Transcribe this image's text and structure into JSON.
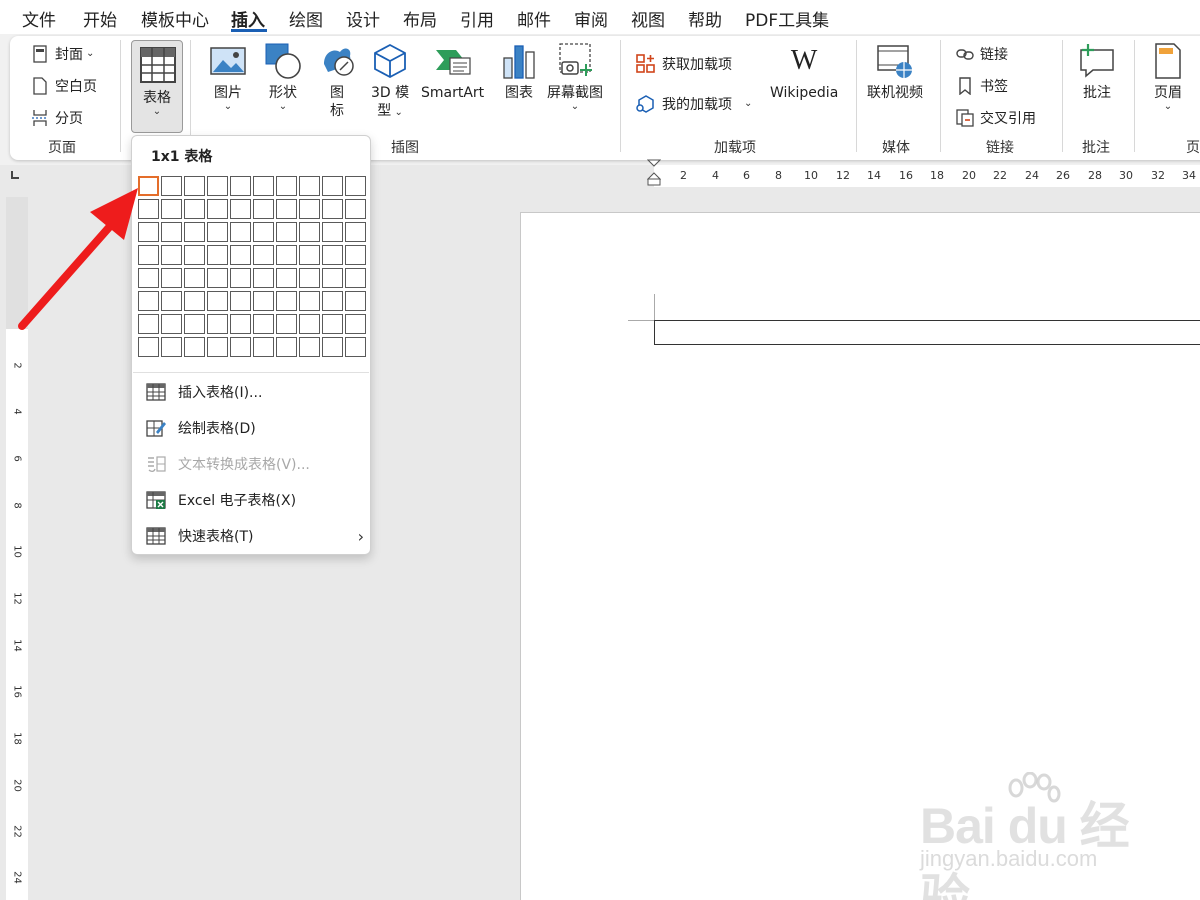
{
  "menu": {
    "tabs": [
      "文件",
      "开始",
      "模板中心",
      "插入",
      "绘图",
      "设计",
      "布局",
      "引用",
      "邮件",
      "审阅",
      "视图",
      "帮助",
      "PDF工具集"
    ],
    "active": "插入"
  },
  "ribbon": {
    "page_group": {
      "label": "页面",
      "items": [
        "封面",
        "空白页",
        "分页"
      ]
    },
    "table_group": {
      "button": "表格"
    },
    "illustrations_group": {
      "label": "插图",
      "picture": "图片",
      "shapes": "形状",
      "icons_l1": "图",
      "icons_l2": "标",
      "model_l1": "3D 模",
      "model_l2": "型",
      "smartart": "SmartArt",
      "chart": "图表",
      "screenshot": "屏幕截图"
    },
    "addins_group": {
      "label": "加载项",
      "get_addins": "获取加载项",
      "my_addins": "我的加载项",
      "wikipedia": "Wikipedia"
    },
    "media_group": {
      "label": "媒体",
      "online_video": "联机视频"
    },
    "links_group": {
      "label": "链接",
      "link": "链接",
      "bookmark": "书签",
      "cross_ref": "交叉引用"
    },
    "comments_group": {
      "label": "批注",
      "comment": "批注"
    },
    "header_group": {
      "label": "页",
      "header": "页眉"
    }
  },
  "ruler": {
    "h_ticks": [
      "2",
      "4",
      "6",
      "8",
      "10",
      "12",
      "14",
      "16",
      "18",
      "20",
      "22",
      "24",
      "26",
      "28",
      "30",
      "32",
      "34"
    ],
    "v_ticks": [
      "2",
      "4",
      "6",
      "8",
      "10",
      "12",
      "14",
      "16",
      "18",
      "20",
      "22",
      "24"
    ]
  },
  "dropdown": {
    "title": "1x1 表格",
    "grid_cols": 10,
    "grid_rows": 8,
    "selected_cols": 1,
    "selected_rows": 1,
    "items": [
      {
        "label": "插入表格(I)...",
        "enabled": true
      },
      {
        "label": "绘制表格(D)",
        "enabled": true
      },
      {
        "label": "文本转换成表格(V)...",
        "enabled": false
      },
      {
        "label": "Excel 电子表格(X)",
        "enabled": true
      },
      {
        "label": "快速表格(T)",
        "enabled": true,
        "submenu": true
      }
    ]
  },
  "watermark": {
    "logo": "Bai du 经验",
    "url": "jingyan.baidu.com"
  },
  "colors": {
    "accent": "#1a5fb4",
    "selected_cell": "#e46d2a",
    "arrow": "#ee1c1c"
  }
}
